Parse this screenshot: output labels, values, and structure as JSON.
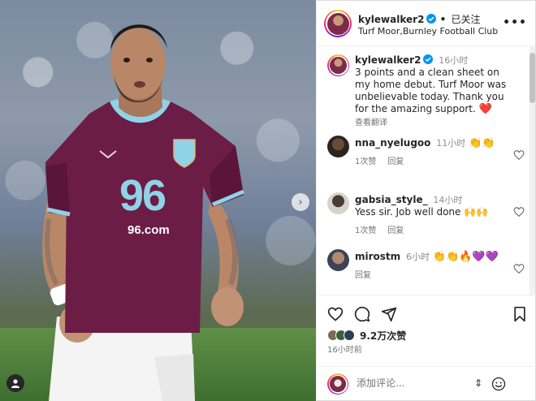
{
  "post": {
    "username": "kylewalker2",
    "follow_status": "已关注",
    "location": "Turf Moor,Burnley Football Club",
    "more": "•••",
    "jersey_number": "96",
    "jersey_sponsor": "96.com"
  },
  "caption": {
    "username": "kylewalker2",
    "time": "16小时",
    "text": "3 points and a clean sheet on my home debut. Turf Moor was unbelievable today. Thank you for the amazing support.",
    "emoji": "❤️",
    "translate": "查看翻译"
  },
  "comments": [
    {
      "username": "nna_nyelugoo",
      "time": "11小时",
      "text": "👏👏",
      "likes": "1次赞",
      "reply": "回复"
    },
    {
      "username": "gabsia_style_",
      "time": "14小时",
      "text": "Yess sir. Job well done 🙌🙌",
      "likes": "1次赞",
      "reply": "回复"
    },
    {
      "username": "mirostm",
      "time": "6小时",
      "text": "👏👏🔥💜💜",
      "likes": "",
      "reply": "回复"
    }
  ],
  "actions": {
    "likes": "9.2万次赞",
    "post_time": "16小时前",
    "add_comment_placeholder": "添加评论...",
    "sort_glyph": "⇕"
  },
  "colors": {
    "verified_blue": "#0095f6",
    "jersey_claret": "#6c1d45",
    "jersey_sky": "#8fd3e8",
    "like_red": "#ed4956"
  },
  "icons": {
    "action_bar": [
      "heart-icon",
      "comment-icon",
      "share-icon",
      "bookmark-icon"
    ],
    "carousel": "chevron-right-icon"
  }
}
